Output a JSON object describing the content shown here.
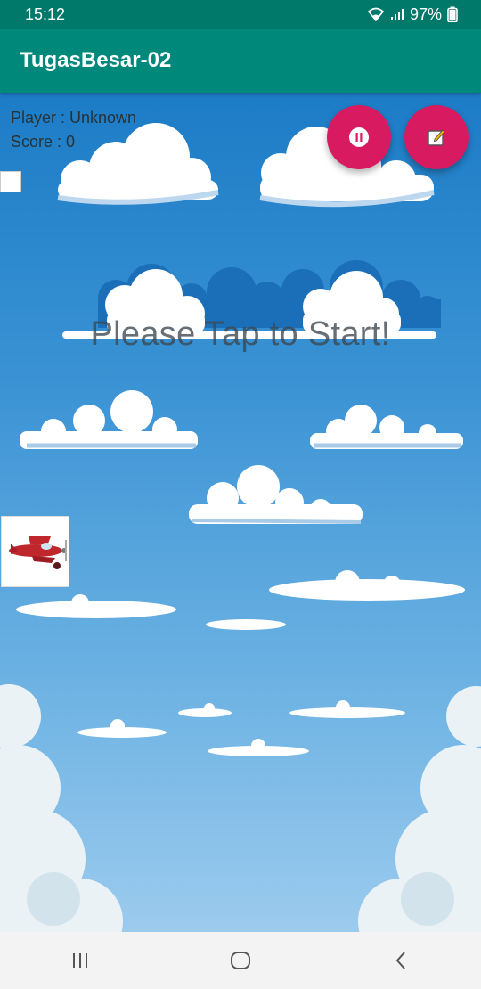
{
  "status_bar": {
    "time": "15:12",
    "battery": "97%"
  },
  "app_bar": {
    "title": "TugasBesar-02"
  },
  "hud": {
    "player": "Player : Unknown",
    "score": "Score : 0"
  },
  "game": {
    "start_message": "Please Tap to Start!"
  },
  "icons": {
    "wifi": "wifi-icon",
    "signal": "signal-icon",
    "battery": "battery-icon",
    "pause": "pause-icon",
    "edit": "edit-icon",
    "plane": "airplane-icon",
    "recents": "recents-icon",
    "home": "home-icon",
    "back": "back-icon"
  },
  "colors": {
    "status_bar": "#00796b",
    "app_bar": "#00897b",
    "fab": "#d81b60",
    "sky_top": "#1c7cc6",
    "sky_bottom": "#9ccbee"
  }
}
